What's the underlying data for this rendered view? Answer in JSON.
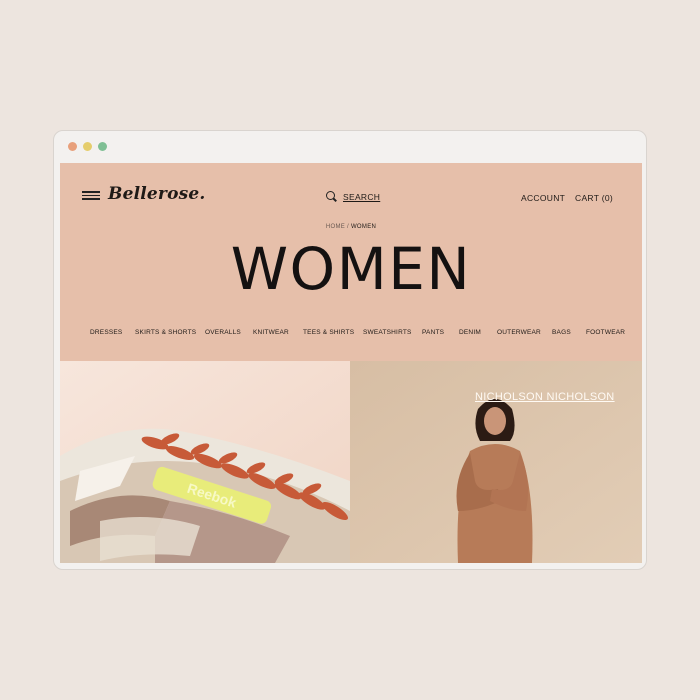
{
  "window": {
    "controls": [
      "close",
      "minimize",
      "maximize"
    ]
  },
  "header": {
    "logo": "Bellerose.",
    "menu_icon": "hamburger-icon",
    "search_label": "SEARCH",
    "account_label": "ACCOUNT",
    "cart_label": "CART (0)"
  },
  "breadcrumb": {
    "home": "HOME",
    "separator": " / ",
    "current": "WOMEN"
  },
  "page_title": "WOMEN",
  "categories": [
    "DRESSES",
    "SKIRTS & SHORTS",
    "OVERALLS",
    "KNITWEAR",
    "TEES & SHIRTS",
    "SWEATSHIRTS",
    "PANTS",
    "DENIM",
    "OUTERWEAR",
    "BAGS",
    "FOOTWEAR"
  ],
  "featured": {
    "left_tag": "Reebok",
    "right_caption": "NICHOLSON NICHOLSON"
  },
  "colors": {
    "page_bg": "#ede5df",
    "header_bg": "#e6bfaa",
    "text": "#1f1a17"
  }
}
